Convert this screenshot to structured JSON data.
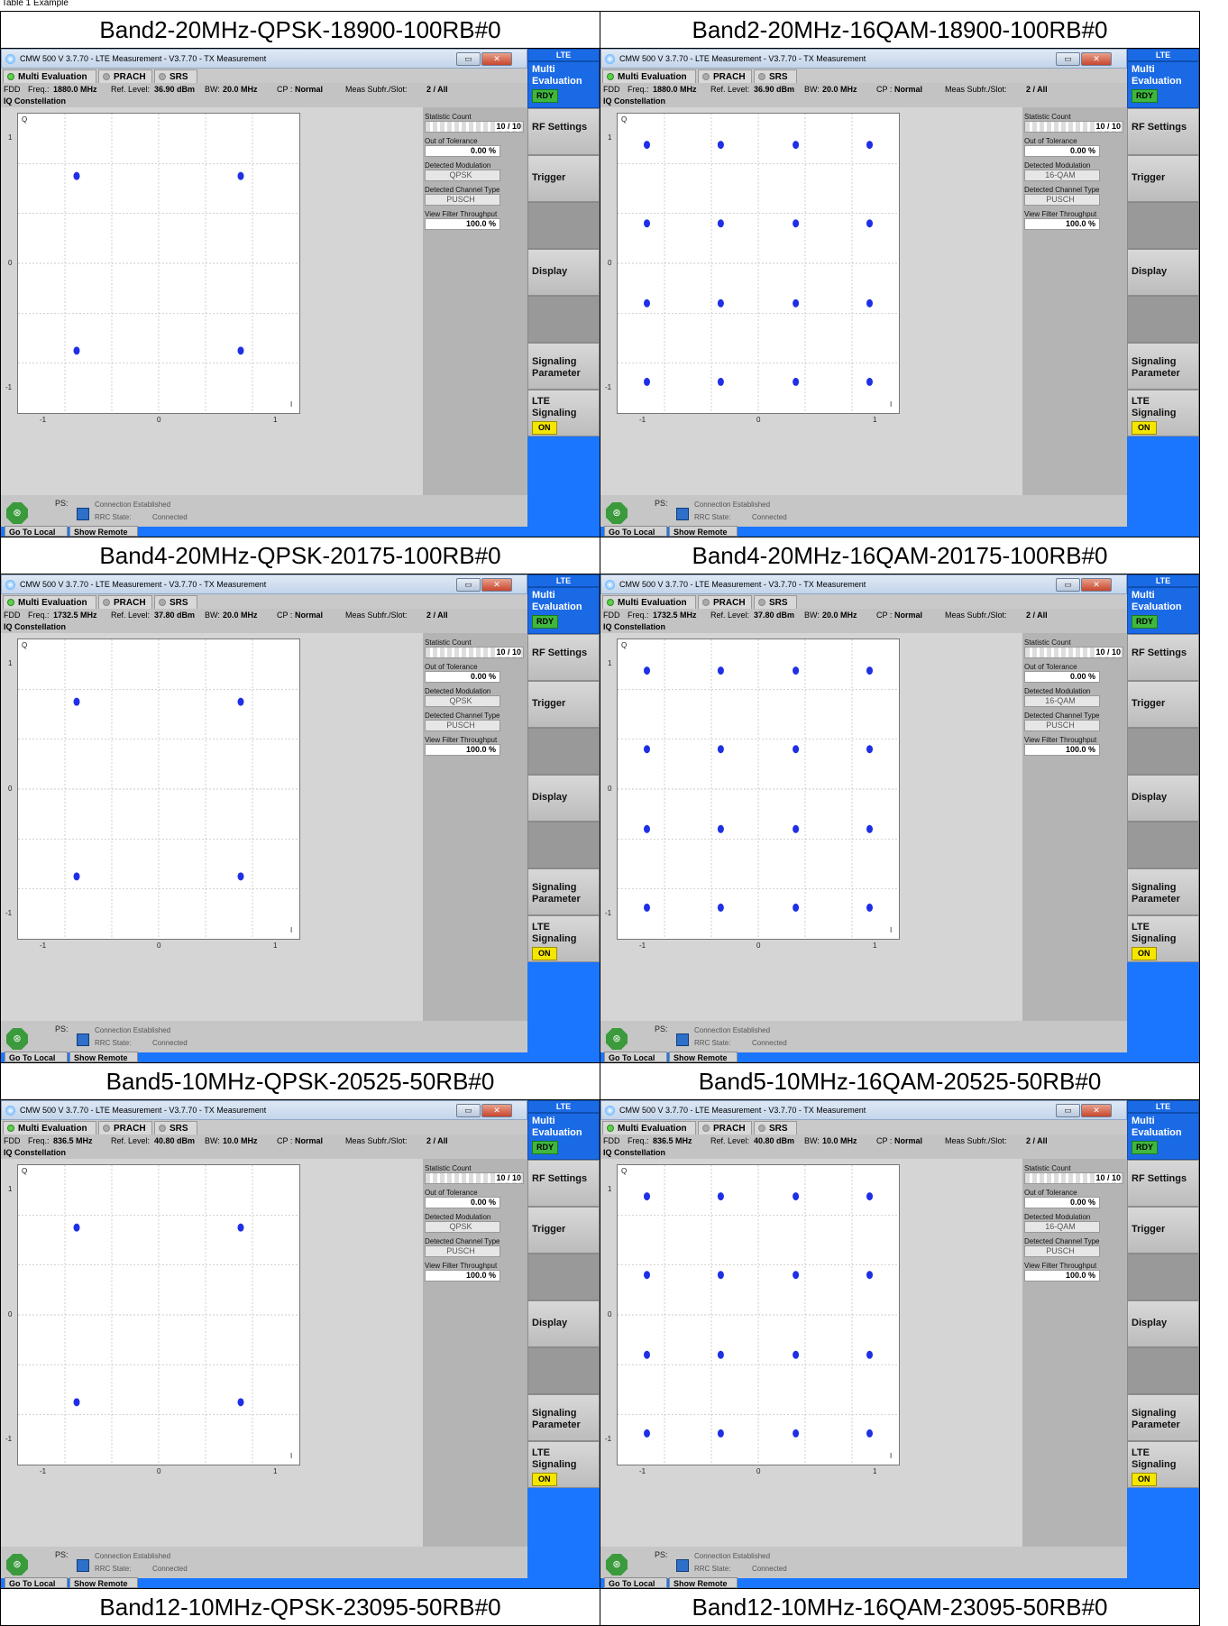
{
  "page_top_text": "Table 1 Example",
  "panels": [
    {
      "caption": "Band2-20MHz-QPSK-18900-100RB#0",
      "mod": "QPSK",
      "freq": "1880.0 MHz",
      "level": "36.90 dBm",
      "bw": "20.0 MHz"
    },
    {
      "caption": "Band2-20MHz-16QAM-18900-100RB#0",
      "mod": "16-QAM",
      "freq": "1880.0 MHz",
      "level": "36.90 dBm",
      "bw": "20.0 MHz"
    },
    {
      "caption": "Band4-20MHz-QPSK-20175-100RB#0",
      "mod": "QPSK",
      "freq": "1732.5 MHz",
      "level": "37.80 dBm",
      "bw": "20.0 MHz"
    },
    {
      "caption": "Band4-20MHz-16QAM-20175-100RB#0",
      "mod": "16-QAM",
      "freq": "1732.5 MHz",
      "level": "37.80 dBm",
      "bw": "20.0 MHz"
    },
    {
      "caption": "Band5-10MHz-QPSK-20525-50RB#0",
      "mod": "QPSK",
      "freq": "836.5 MHz",
      "level": "40.80 dBm",
      "bw": "10.0 MHz"
    },
    {
      "caption": "Band5-10MHz-16QAM-20525-50RB#0",
      "mod": "16-QAM",
      "freq": "836.5 MHz",
      "level": "40.80 dBm",
      "bw": "10.0 MHz"
    }
  ],
  "bottom_captions": [
    "Band12-10MHz-QPSK-23095-50RB#0",
    "Band12-10MHz-16QAM-23095-50RB#0"
  ],
  "common": {
    "title": "CMW 500 V 3.7.70 - LTE Measurement - V3.7.70 - TX Measurement",
    "tab_multi": "Multi Evaluation",
    "tab_prach": "PRACH",
    "tab_srs": "SRS",
    "fdd": "FDD",
    "freq_label": "Freq.:",
    "ref_label": "Ref. Level:",
    "bw_label": "BW:",
    "cp_label": "CP :",
    "cp_value": "Normal",
    "meas_label": "Meas Subfr./Slot:",
    "meas_value": "2 / All",
    "iq_title": "IQ Constellation",
    "q_axis": "Q",
    "i_axis": "I",
    "y_ticks": [
      "1",
      "0",
      "-1"
    ],
    "x_ticks": [
      "-1",
      "0",
      "1"
    ],
    "stat_count_label": "Statistic Count",
    "stat_count_value": "10 / 10",
    "oot_label": "Out of Tolerance",
    "oot_value": "0.00 %",
    "det_mod_label": "Detected Modulation",
    "det_chan_label": "Detected Channel Type",
    "det_chan_value": "PUSCH",
    "vft_label": "View Filter Throughput",
    "vft_value": "100.0 %",
    "ps_label": "PS:",
    "conn_status": "Connection Established",
    "rrc_label": "RRC State:",
    "rrc_value": "Connected",
    "sk_lte": "LTE",
    "sk_multi": "Multi Evaluation",
    "sk_rdy": "RDY",
    "sk_rf": "RF Settings",
    "sk_trigger": "Trigger",
    "sk_display": "Display",
    "sk_sigparam": "Signaling Parameter",
    "sk_ltesig": "LTE Signaling",
    "sk_on": "ON",
    "btn_local": "Go To Local",
    "btn_remote": "Show Remote Screen"
  },
  "colors": {
    "accent": "#1a75ff",
    "constellation": "#1f2fe6",
    "rdy": "#3fb73f",
    "on": "#f5e600"
  },
  "chart_data": [
    {
      "type": "scatter",
      "title": "IQ Constellation",
      "modulation": "QPSK",
      "x": [
        -0.7,
        0.7,
        -0.7,
        0.7
      ],
      "y": [
        0.7,
        0.7,
        -0.7,
        -0.7
      ],
      "xlim": [
        -1.2,
        1.2
      ],
      "ylim": [
        -1.2,
        1.2
      ]
    },
    {
      "type": "scatter",
      "title": "IQ Constellation",
      "modulation": "16-QAM",
      "x": [
        -0.95,
        -0.32,
        0.32,
        0.95,
        -0.95,
        -0.32,
        0.32,
        0.95,
        -0.95,
        -0.32,
        0.32,
        0.95,
        -0.95,
        -0.32,
        0.32,
        0.95
      ],
      "y": [
        0.95,
        0.95,
        0.95,
        0.95,
        0.32,
        0.32,
        0.32,
        0.32,
        -0.32,
        -0.32,
        -0.32,
        -0.32,
        -0.95,
        -0.95,
        -0.95,
        -0.95
      ],
      "xlim": [
        -1.2,
        1.2
      ],
      "ylim": [
        -1.2,
        1.2
      ]
    }
  ]
}
